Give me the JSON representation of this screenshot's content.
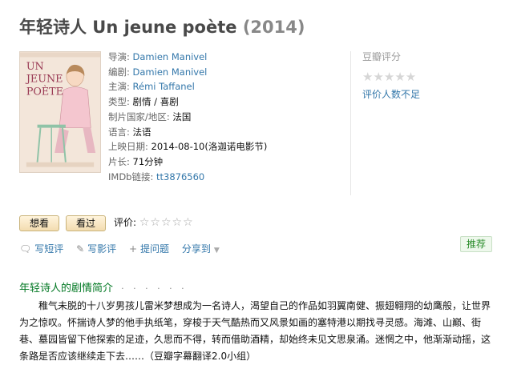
{
  "title": {
    "main": "年轻诗人 Un jeune poète",
    "year": "(2014)"
  },
  "poster": {
    "line1": "UN",
    "line2": "JEUNE",
    "line3": "POÈTE"
  },
  "info": {
    "director_label": "导演:",
    "director": "Damien Manivel",
    "writer_label": "编剧:",
    "writer": "Damien Manivel",
    "cast_label": "主演:",
    "cast": "Rémi Taffanel",
    "genre_label": "类型:",
    "genre": "剧情 / 喜剧",
    "country_label": "制片国家/地区:",
    "country": "法国",
    "language_label": "语言:",
    "language": "法语",
    "release_label": "上映日期:",
    "release": "2014-08-10(洛迦诺电影节)",
    "runtime_label": "片长:",
    "runtime": "71分钟",
    "imdb_label": "IMDb链接:",
    "imdb": "tt3876560"
  },
  "rating": {
    "label": "豆瓣评分",
    "stars": "★★★★★",
    "note": "评价人数不足"
  },
  "buttons": {
    "want": "想看",
    "seen": "看过",
    "rate_label": "评价:",
    "rate_stars": "☆☆☆☆☆"
  },
  "actions": {
    "short_review": "写短评",
    "review": "写影评",
    "question": "提问题",
    "share": "分享到"
  },
  "recommend": "推荐",
  "summary": {
    "title": "年轻诗人的剧情简介",
    "dots": "· · · · · ·",
    "text": "稚气未脱的十八岁男孩儿雷米梦想成为一名诗人，渴望自己的作品如羽翼南健、振翅翱翔的幼鹰般，让世界为之惊叹。怀揣诗人梦的他手执纸笔，穿梭于天气酷热而又风景如画的塞特港以期找寻灵感。海滩、山巅、街巷、墓园皆留下他探索的足迹，久思而不得，转而借助酒精，却始终未见文思泉涌。迷惘之中，他渐渐动摇，这条路是否应该继续走下去……（豆瓣字幕翻译2.0小组）"
  }
}
